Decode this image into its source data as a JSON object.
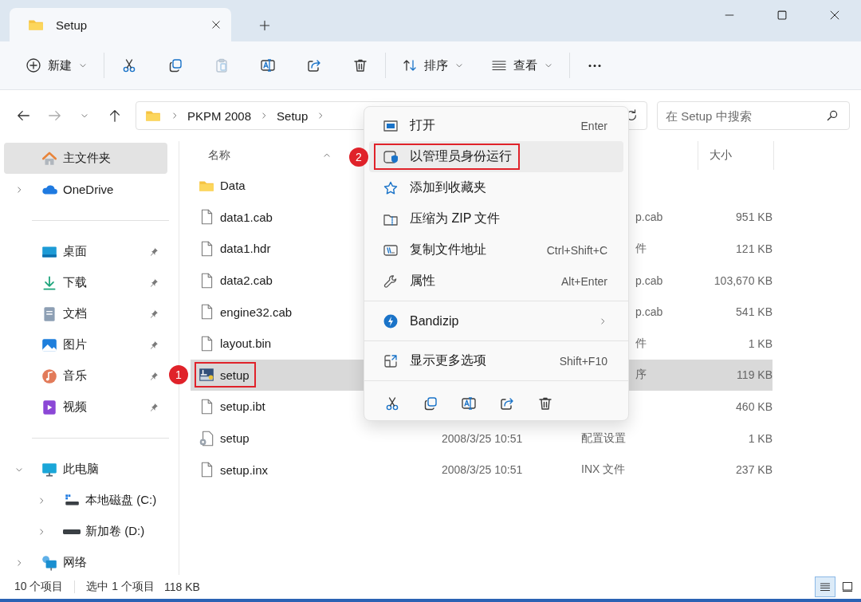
{
  "tab": {
    "title": "Setup"
  },
  "toolbar": {
    "new_label": "新建",
    "sort_label": "排序",
    "view_label": "查看",
    "buttons": [
      {
        "kind": "cut",
        "disabled": false
      },
      {
        "kind": "copy",
        "disabled": false
      },
      {
        "kind": "paste",
        "disabled": true
      },
      {
        "kind": "rename",
        "disabled": false
      },
      {
        "kind": "share",
        "disabled": false
      },
      {
        "kind": "delete",
        "disabled": false
      }
    ]
  },
  "nav": {
    "back_disabled": false,
    "forward_disabled": true
  },
  "breadcrumb": [
    "PKPM 2008",
    "Setup"
  ],
  "search": {
    "placeholder": "在 Setup 中搜索"
  },
  "sidebar": {
    "groups": [
      [
        {
          "kind": "home",
          "label": "主文件夹",
          "selected": true
        },
        {
          "kind": "cloud",
          "label": "OneDrive",
          "selected": false,
          "expanded": false
        }
      ],
      [
        {
          "kind": "desktop",
          "label": "桌面",
          "selected": false,
          "pinned": true
        },
        {
          "kind": "download",
          "label": "下载",
          "selected": false,
          "pinned": true
        },
        {
          "kind": "document",
          "label": "文档",
          "selected": false,
          "pinned": true
        },
        {
          "kind": "image",
          "label": "图片",
          "selected": false,
          "pinned": true
        },
        {
          "kind": "music",
          "label": "音乐",
          "selected": false,
          "pinned": true
        },
        {
          "kind": "video",
          "label": "视频",
          "selected": false,
          "pinned": true
        }
      ],
      [
        {
          "kind": "pc",
          "label": "此电脑",
          "selected": false,
          "expanded": true,
          "children": [
            {
              "kind": "drive-c",
              "label": "本地磁盘 (C:)",
              "selected": false,
              "expanded": false
            },
            {
              "kind": "drive",
              "label": "新加卷 (D:)",
              "selected": false,
              "expanded": false
            }
          ]
        },
        {
          "kind": "network",
          "label": "网络",
          "selected": false,
          "expanded": false
        }
      ]
    ]
  },
  "file_list": {
    "columns": {
      "name": "名称",
      "size": "大小"
    },
    "rows": [
      {
        "kind": "folder",
        "name": "Data",
        "selected": false
      },
      {
        "kind": "file",
        "name": "data1.cab",
        "selected": false,
        "covered": true,
        "type": "p.cab",
        "size": "951 KB"
      },
      {
        "kind": "file",
        "name": "data1.hdr",
        "selected": false,
        "covered": true,
        "type": "件",
        "size": "121 KB"
      },
      {
        "kind": "file",
        "name": "data2.cab",
        "selected": false,
        "covered": true,
        "type": "p.cab",
        "size": "103,670 KB"
      },
      {
        "kind": "file",
        "name": "engine32.cab",
        "selected": false,
        "covered": true,
        "type": "p.cab",
        "size": "541 KB"
      },
      {
        "kind": "file",
        "name": "layout.bin",
        "selected": false,
        "covered": true,
        "type": "件",
        "size": "1 KB"
      },
      {
        "kind": "app",
        "name": "setup",
        "selected": true,
        "covered": true,
        "type": "序",
        "size": "119 KB",
        "annotation": "1"
      },
      {
        "kind": "file",
        "name": "setup.ibt",
        "selected": false,
        "size": "460 KB"
      },
      {
        "kind": "config",
        "name": "setup",
        "selected": false,
        "covered": false,
        "date": "2008/3/25 10:51",
        "type": "配置设置",
        "size": "1 KB"
      },
      {
        "kind": "file",
        "name": "setup.inx",
        "selected": false,
        "covered": false,
        "date": "2008/3/25 10:51",
        "type": "INX 文件",
        "size": "237 KB"
      }
    ]
  },
  "context_menu": {
    "groups": [
      [
        {
          "kind": "open",
          "label": "打开",
          "shortcut": "Enter",
          "selected": false
        },
        {
          "kind": "admin",
          "label": "以管理员身份运行",
          "selected": true,
          "annotation": "2"
        },
        {
          "kind": "star",
          "label": "添加到收藏夹",
          "selected": false
        },
        {
          "kind": "zip",
          "label": "压缩为 ZIP 文件",
          "selected": false
        },
        {
          "kind": "path",
          "label": "复制文件地址",
          "shortcut": "Ctrl+Shift+C",
          "selected": false
        },
        {
          "kind": "wrench",
          "label": "属性",
          "shortcut": "Alt+Enter",
          "selected": false
        }
      ],
      [
        {
          "kind": "bandizip",
          "label": "Bandizip",
          "selected": false,
          "submenu": true
        }
      ],
      [
        {
          "kind": "more",
          "label": "显示更多选项",
          "shortcut": "Shift+F10",
          "selected": false
        }
      ]
    ],
    "actions": [
      {
        "kind": "cut"
      },
      {
        "kind": "copy"
      },
      {
        "kind": "rename"
      },
      {
        "kind": "share"
      },
      {
        "kind": "delete"
      }
    ]
  },
  "status_bar": {
    "count": "10 个项目",
    "selection": "选中 1 个项目",
    "selection_size": "118 KB",
    "views": [
      {
        "kind": "details",
        "selected": true
      },
      {
        "kind": "tiles",
        "selected": false
      }
    ]
  }
}
